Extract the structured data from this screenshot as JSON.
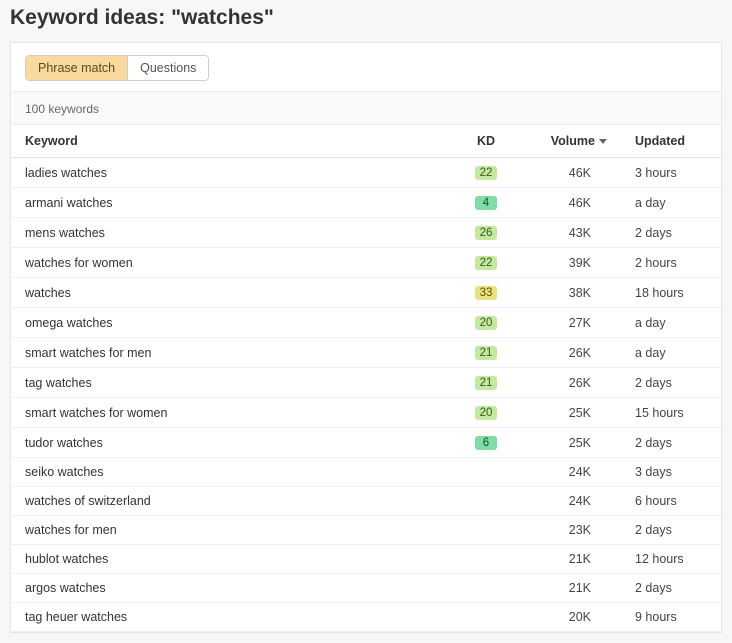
{
  "title_prefix": "Keyword ideas: ",
  "title_term": "\"watches\"",
  "tabs": {
    "phrase_match": "Phrase match",
    "questions": "Questions"
  },
  "count_text": "100 keywords",
  "columns": {
    "keyword": "Keyword",
    "kd": "KD",
    "volume": "Volume",
    "updated": "Updated"
  },
  "rows": [
    {
      "keyword": "ladies watches",
      "kd": "22",
      "kd_tone": "lightgreen",
      "volume": "46K",
      "updated": "3 hours"
    },
    {
      "keyword": "armani watches",
      "kd": "4",
      "kd_tone": "green",
      "volume": "46K",
      "updated": "a day"
    },
    {
      "keyword": "mens watches",
      "kd": "26",
      "kd_tone": "lightgreen",
      "volume": "43K",
      "updated": "2 days"
    },
    {
      "keyword": "watches for women",
      "kd": "22",
      "kd_tone": "lightgreen",
      "volume": "39K",
      "updated": "2 hours"
    },
    {
      "keyword": "watches",
      "kd": "33",
      "kd_tone": "yellow",
      "volume": "38K",
      "updated": "18 hours"
    },
    {
      "keyword": "omega watches",
      "kd": "20",
      "kd_tone": "lightgreen",
      "volume": "27K",
      "updated": "a day"
    },
    {
      "keyword": "smart watches for men",
      "kd": "21",
      "kd_tone": "lightgreen",
      "volume": "26K",
      "updated": "a day"
    },
    {
      "keyword": "tag watches",
      "kd": "21",
      "kd_tone": "lightgreen",
      "volume": "26K",
      "updated": "2 days"
    },
    {
      "keyword": "smart watches for women",
      "kd": "20",
      "kd_tone": "lightgreen",
      "volume": "25K",
      "updated": "15 hours"
    },
    {
      "keyword": "tudor watches",
      "kd": "6",
      "kd_tone": "green",
      "volume": "25K",
      "updated": "2 days"
    },
    {
      "keyword": "seiko watches",
      "kd": "",
      "kd_tone": "",
      "volume": "24K",
      "updated": "3 days"
    },
    {
      "keyword": "watches of switzerland",
      "kd": "",
      "kd_tone": "",
      "volume": "24K",
      "updated": "6 hours"
    },
    {
      "keyword": "watches for men",
      "kd": "",
      "kd_tone": "",
      "volume": "23K",
      "updated": "2 days"
    },
    {
      "keyword": "hublot watches",
      "kd": "",
      "kd_tone": "",
      "volume": "21K",
      "updated": "12 hours"
    },
    {
      "keyword": "argos watches",
      "kd": "",
      "kd_tone": "",
      "volume": "21K",
      "updated": "2 days"
    },
    {
      "keyword": "tag heuer watches",
      "kd": "",
      "kd_tone": "",
      "volume": "20K",
      "updated": "9 hours"
    }
  ]
}
